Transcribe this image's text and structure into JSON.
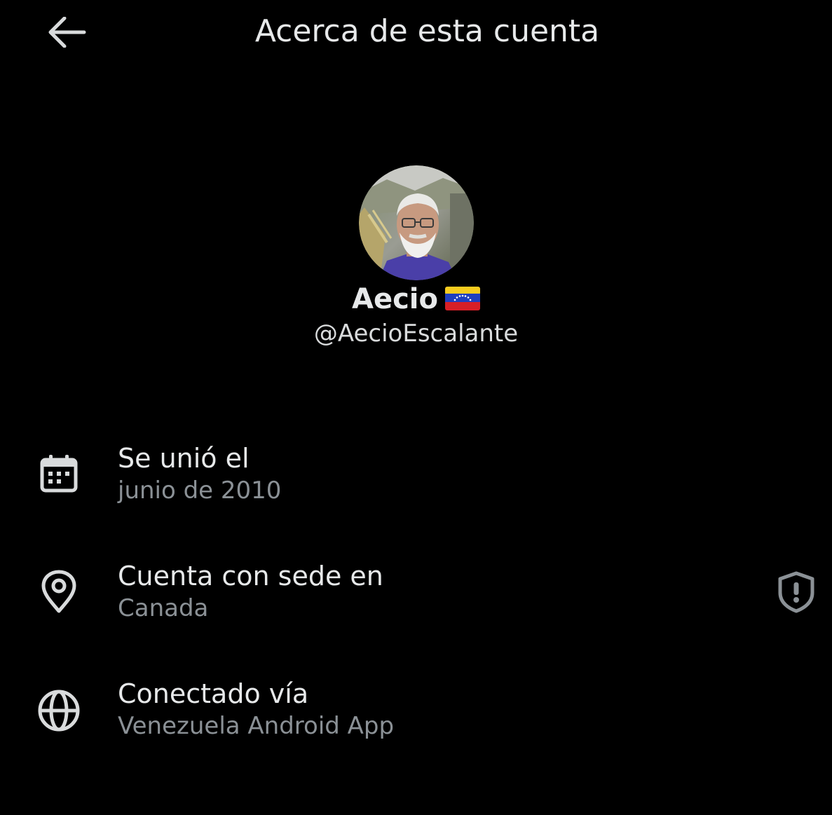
{
  "header": {
    "title": "Acerca de esta cuenta",
    "back_icon": "arrow-left-icon"
  },
  "profile": {
    "display_name": "Aecio",
    "flag_icon": "venezuela-flag-icon",
    "handle": "@AecioEscalante"
  },
  "info": [
    {
      "icon": "calendar-icon",
      "title": "Se unió el",
      "value": "junio de 2010"
    },
    {
      "icon": "location-pin-icon",
      "title": "Cuenta con sede en",
      "value": "Canada",
      "badge_icon": "shield-alert-icon"
    },
    {
      "icon": "globe-icon",
      "title": "Conectado vía",
      "value": "Venezuela Android App"
    }
  ],
  "colors": {
    "background": "#000000",
    "primary_text": "#e7e9ea",
    "secondary_text": "#8b9196",
    "icon": "#d9dbdc"
  }
}
